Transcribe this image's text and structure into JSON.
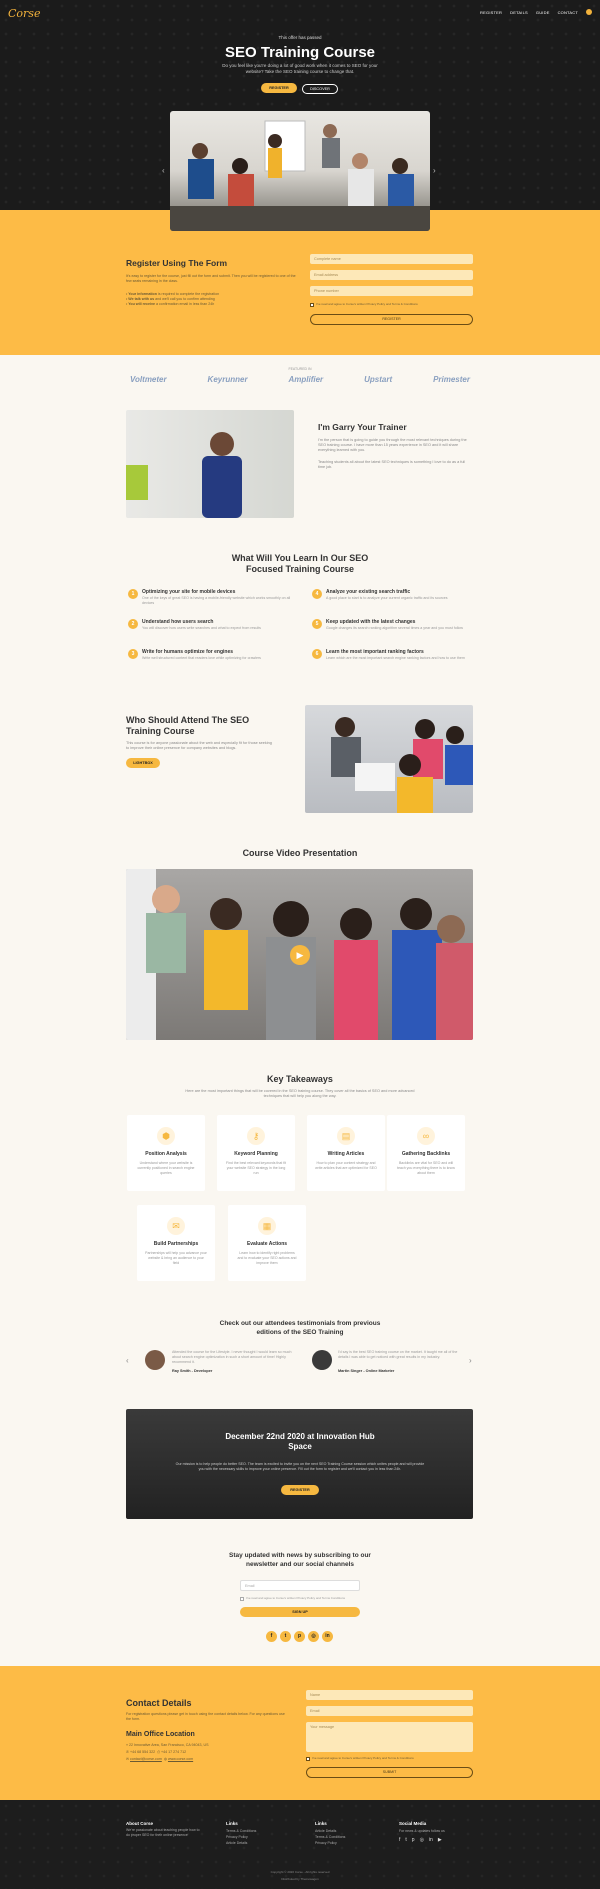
{
  "brand": {
    "logo": "Corse",
    "accent": "#f6b840"
  },
  "nav": {
    "items": [
      "REGISTER",
      "DETAILS",
      "GUIDE",
      "CONTACT"
    ]
  },
  "hero": {
    "pre": "This offer has passed",
    "title": "SEO Training Course",
    "subtitle": "Do you feel like you're doing a lot of good work when it comes to SEO for your website? Take the SEO training course to change that.",
    "btn_register": "REGISTER",
    "btn_discover": "DISCOVER"
  },
  "register": {
    "title": "Register Using The Form",
    "desc": "It's easy to register for the course, just fill out the form and submit. Then you will be registered to one of the few seats remaining in the class.",
    "bullets": [
      {
        "bold": "Your information",
        "rest": " is required to complete the registration"
      },
      {
        "bold": "We talk with us",
        "rest": " and we'll call you to confirm attending"
      },
      {
        "bold": "You will receive",
        "rest": " a confirmation email in less than 24h"
      }
    ],
    "field_name": "Complete name",
    "field_email": "Email address",
    "field_phone": "Phone number",
    "terms": "I've read and agree to Corse's written Privacy Policy and Terms & Conditions",
    "submit": "REGISTER"
  },
  "featured": {
    "label": "FEATURED IN",
    "logos": [
      "Voltmeter",
      "Keyrunner",
      "Amplifier",
      "Upstart",
      "Primester"
    ]
  },
  "trainer": {
    "title": "I'm Garry Your Trainer",
    "p1": "I'm the person that is going to guide you through the most relevant techniques during the SEO training course. I have more than 15 years experience in SEO and it will share everything learned with you.",
    "p2": "Teaching students all about the latest SEO techniques is something I love to do as a full time job."
  },
  "learn": {
    "title": "What Will You Learn In Our SEO Focused Training Course",
    "items": [
      {
        "n": "1",
        "t": "Optimizing your site for mobile devices",
        "d": "One of the keys of great SEO is having a mobile-friendly website which works smoothly on all devices"
      },
      {
        "n": "2",
        "t": "Understand how users search",
        "d": "You will discover how users write searches and what to expect from results"
      },
      {
        "n": "3",
        "t": "Write for humans optimize for engines",
        "d": "Write well structured content that readers love while optimizing for crawlers"
      },
      {
        "n": "4",
        "t": "Analyze your existing search traffic",
        "d": "A good place to start is to analyze your current organic traffic and its sources"
      },
      {
        "n": "5",
        "t": "Keep updated with the latest changes",
        "d": "Google changes its search ranking algorithm several times a year and you must follow"
      },
      {
        "n": "6",
        "t": "Learn the most important ranking factors",
        "d": "Learn which are the most important search engine ranking factors and how to use them"
      }
    ]
  },
  "attend": {
    "title": "Who Should Attend The SEO Training Course",
    "desc": "This course is for anyone passionate about the web and especially fit for those seeking to improve their online presence for company websites and blogs.",
    "btn": "LIGHTBOX"
  },
  "video": {
    "title": "Course Video Presentation"
  },
  "takeaways": {
    "title": "Key Takeaways",
    "desc": "Here are the most important things that will be covered in the SEO training course. They cover all the basics of SEO and more advanced techniques that will help you along the way.",
    "cards": [
      {
        "icon": "cube-icon",
        "glyph": "⬢",
        "t": "Position Analysis",
        "d": "Understand where your website is currently positioned in search engine queries"
      },
      {
        "icon": "key-icon",
        "glyph": "⚷",
        "t": "Keyword Planning",
        "d": "Find the best relevant keywords that fit your website SEO strategy in the long run"
      },
      {
        "icon": "article-icon",
        "glyph": "▤",
        "t": "Writing Articles",
        "d": "How to plan your content strategy and write articles that are optimized for SEO"
      },
      {
        "icon": "link-icon",
        "glyph": "∞",
        "t": "Gathering Backlinks",
        "d": "Backlinks are vital for SEO and will teach you everything there is to know about them"
      },
      {
        "icon": "handshake-icon",
        "glyph": "✉",
        "t": "Build Partnerships",
        "d": "Partnerships will help you advance your website & bring an audience to your field"
      },
      {
        "icon": "chart-icon",
        "glyph": "▦",
        "t": "Evaluate Actions",
        "d": "Learn how to identify right problems and to evaluate your SEO actions and improve them"
      }
    ]
  },
  "testimonials": {
    "title": "Check out our attendees testimonials from previous editions of the SEO Training",
    "items": [
      {
        "q": "Attended the course for the Lifestyle. I never thought I would learn so much about search engine optimization in such a short amount of time! Highly recommend it.",
        "who": "Ray Smith - Developer"
      },
      {
        "q": "I'd say is the best SEO training course on the market. It taught me all of the details I was able to get noticed with great results in my industry.",
        "who": "Martin Singer - Online Marketer"
      }
    ]
  },
  "event": {
    "title": "December 22nd 2020 at Innovation Hub Space",
    "desc": "Our mission is to help people do better SEO. The team is excited to invite you on the next SEO Training Course session which unites people and will provide you with the necessary skills to improve your online presence. Fill out the form to register and we'll contact you in less than 24h.",
    "btn": "REGISTER"
  },
  "newsletter": {
    "title": "Stay updated with news by subscribing to our newsletter and our social channels",
    "placeholder": "Email",
    "terms": "I've read and agree to Corse's written Privacy Policy and Terms Conditions",
    "btn": "SIGN UP"
  },
  "contact": {
    "title": "Contact Details",
    "desc": "For registration questions please get in touch using the contact details below. For any questions use the form.",
    "office": "Main Office Location",
    "address": "22 Innovative Area, San Francisco, CA 94043, US",
    "phone": "+44 68 554 322",
    "fax": "+44 17 274 712",
    "email": "contact@corse.com",
    "web": "www.corse.com",
    "field_name": "Name",
    "field_email": "Email",
    "field_message": "Your message",
    "terms": "I've read and agree to Corse's written Privacy Policy and Terms & Conditions",
    "submit": "SUBMIT"
  },
  "footer": {
    "about_title": "About Corse",
    "about_text": "We're passionate about teaching people how to do proper SEO for their online presence",
    "links1_title": "Links",
    "links1": [
      "Terms & Conditions",
      "Privacy Policy",
      "Article Details"
    ],
    "links2_title": "Links",
    "links2": [
      "Article Details",
      "Terms & Conditions",
      "Privacy Policy"
    ],
    "social_title": "Social Media",
    "social_text": "For news & updates follow us",
    "copyright": "Copyright © 2020 Corse - All rights reserved",
    "distributed": "Distributed by Themewagon"
  }
}
